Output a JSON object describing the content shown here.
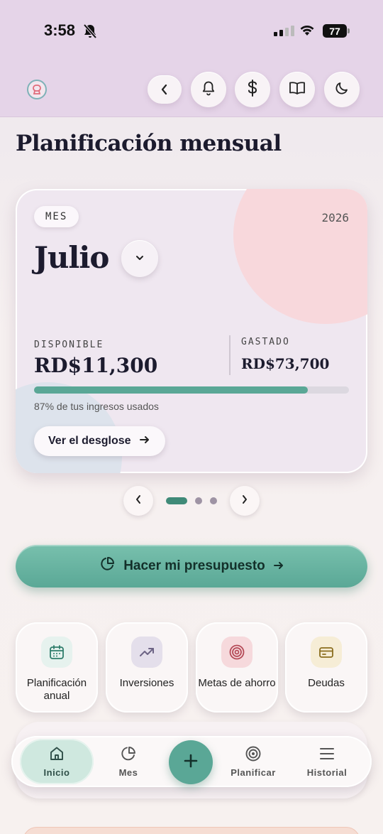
{
  "status": {
    "time": "3:58",
    "battery": "77"
  },
  "header": {
    "buttons": [
      "back",
      "notifications",
      "currency",
      "guide",
      "dark-mode"
    ]
  },
  "page": {
    "title": "Planificación mensual"
  },
  "month_card": {
    "chip": "MES",
    "year": "2026",
    "month": "Julio",
    "available_label": "DISPONIBLE",
    "available_value": "RD$11,300",
    "spent_label": "GASTADO",
    "spent_value": "RD$73,700",
    "usage_fraction": 0.87,
    "usage_text": "87% de tus ingresos usados",
    "breakdown_button": "Ver el desglose",
    "pager_pages": 3,
    "pager_active": 0
  },
  "budget_button": {
    "label": "Hacer mi presupuesto"
  },
  "quick_actions": [
    {
      "label": "Planificación anual",
      "icon": "calendar-icon"
    },
    {
      "label": "Inversiones",
      "icon": "trending-up-icon"
    },
    {
      "label": "Metas de ahorro",
      "icon": "target-icon"
    },
    {
      "label": "Deudas",
      "icon": "credit-card-icon"
    }
  ],
  "nav": {
    "items": [
      {
        "label": "Inicio",
        "icon": "home-icon",
        "active": true
      },
      {
        "label": "Mes",
        "icon": "pie-chart-icon",
        "active": false
      },
      {
        "label": "Planificar",
        "icon": "target-icon",
        "active": false
      },
      {
        "label": "Historial",
        "icon": "menu-icon",
        "active": false
      }
    ]
  },
  "colors": {
    "accent": "#5aa796",
    "header_bg": "#e5d4e8",
    "card_bg": "#efe7f0",
    "blob_pink": "#f8d8dc",
    "progress_track": "#dcd8e0"
  }
}
